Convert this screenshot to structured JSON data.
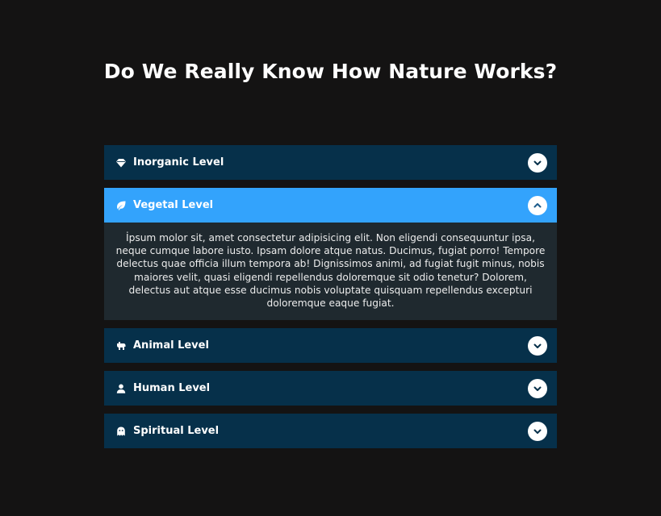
{
  "page": {
    "title": "Do We Really Know How Nature Works?"
  },
  "colors": {
    "background": "#141313",
    "header_collapsed": "#06304a",
    "header_active": "#33a3fc",
    "panel_body": "#1f292f"
  },
  "accordion": {
    "items": [
      {
        "label": "Inorganic Level",
        "icon": "gem-icon",
        "expanded": false
      },
      {
        "label": "Vegetal Level",
        "icon": "leaf-icon",
        "expanded": true,
        "content": "İpsum molor sit, amet consectetur adipisicing elit. Non eligendi consequuntur ipsa, neque cumque labore iusto. Ipsam dolore atque natus. Ducimus, fugiat porro! Tempore delectus quae officia illum tempora ab! Dignissimos animi, ad fugiat fugit minus, nobis maiores velit, quasi eligendi repellendus doloremque sit odio tenetur? Dolorem, delectus aut atque esse ducimus nobis voluptate quisquam repellendus excepturi doloremque eaque fugiat."
      },
      {
        "label": "Animal Level",
        "icon": "hippo-icon",
        "expanded": false
      },
      {
        "label": "Human Level",
        "icon": "user-icon",
        "expanded": false
      },
      {
        "label": "Spiritual Level",
        "icon": "ghost-icon",
        "expanded": false
      }
    ]
  }
}
